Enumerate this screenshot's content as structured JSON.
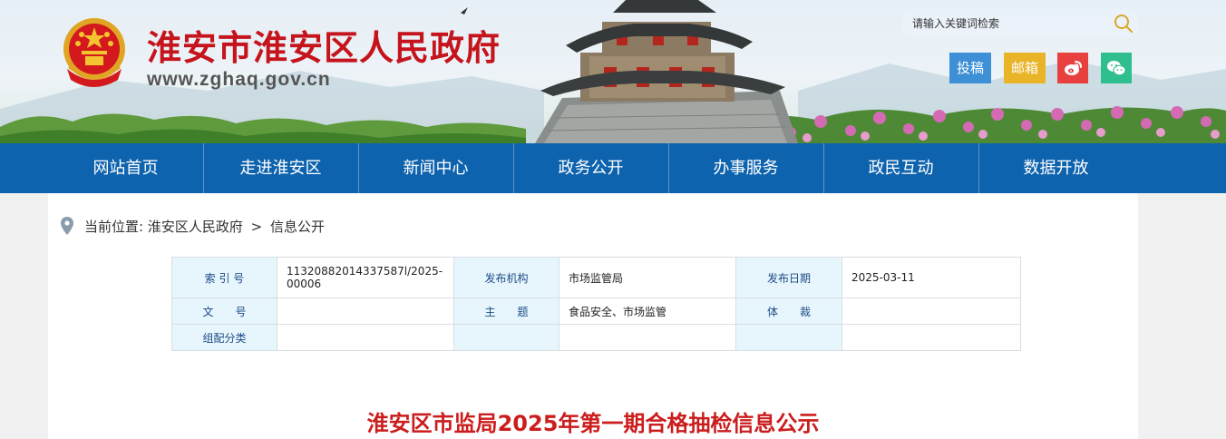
{
  "header": {
    "site_title": "淮安市淮安区人民政府",
    "site_url": "www.zghaq.gov.cn",
    "search_placeholder": "请输入关键词检索",
    "tools": {
      "submit_label": "投稿",
      "mailbox_label": "邮箱",
      "weibo_icon": "weibo-icon",
      "wechat_icon": "wechat-icon"
    }
  },
  "nav": {
    "items": [
      {
        "label": "网站首页"
      },
      {
        "label": "走进淮安区"
      },
      {
        "label": "新闻中心"
      },
      {
        "label": "政务公开"
      },
      {
        "label": "办事服务"
      },
      {
        "label": "政民互动"
      },
      {
        "label": "数据开放"
      }
    ]
  },
  "breadcrumb": {
    "prefix": "当前位置:",
    "items": [
      "淮安区人民政府",
      "信息公开"
    ],
    "separator": ">"
  },
  "meta_table": {
    "rows": [
      [
        {
          "label": "索 引 号",
          "value": "11320882014337587l/2025-00006"
        },
        {
          "label": "发布机构",
          "value": "市场监管局"
        },
        {
          "label": "发布日期",
          "value": "2025-03-11"
        }
      ],
      [
        {
          "label": "文　　号",
          "value": ""
        },
        {
          "label": "主　　题",
          "value": "食品安全、市场监管"
        },
        {
          "label": "体　　裁",
          "value": ""
        }
      ],
      [
        {
          "label": "组配分类",
          "value": ""
        },
        {
          "label": "",
          "value": ""
        },
        {
          "label": "",
          "value": ""
        }
      ]
    ]
  },
  "article": {
    "title": "淮安区市监局2025年第一期合格抽检信息公示"
  },
  "colors": {
    "nav_bg": "#0e63ae",
    "title_red": "#c5141c",
    "article_title_red": "#cc1d1d",
    "label_bg": "#e7f5fd"
  }
}
